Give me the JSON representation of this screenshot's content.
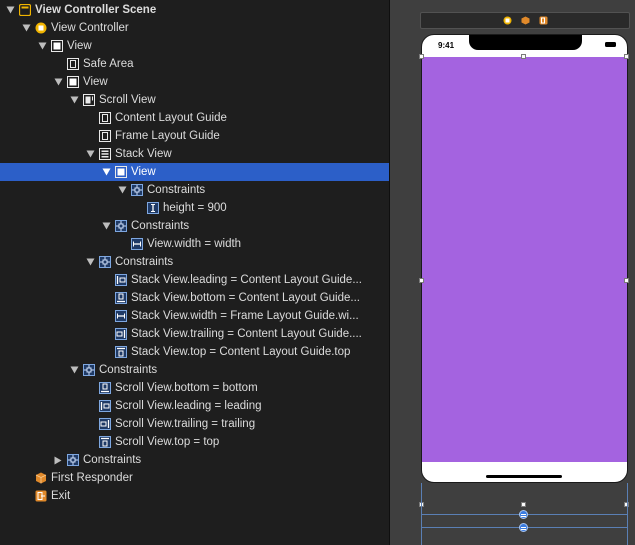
{
  "outline": {
    "items": [
      {
        "label": "View Controller Scene",
        "depth": 0,
        "expanded": true,
        "icon": "scene-icon",
        "bold": true
      },
      {
        "label": "View Controller",
        "depth": 1,
        "expanded": true,
        "icon": "view-controller-icon"
      },
      {
        "label": "View",
        "depth": 2,
        "expanded": true,
        "icon": "view-icon"
      },
      {
        "label": "Safe Area",
        "depth": 3,
        "expanded": null,
        "icon": "layout-guide-icon"
      },
      {
        "label": "View",
        "depth": 3,
        "expanded": true,
        "icon": "view-icon"
      },
      {
        "label": "Scroll View",
        "depth": 4,
        "expanded": true,
        "icon": "scroll-view-icon"
      },
      {
        "label": "Content Layout Guide",
        "depth": 5,
        "expanded": null,
        "icon": "layout-guide-icon"
      },
      {
        "label": "Frame Layout Guide",
        "depth": 5,
        "expanded": null,
        "icon": "layout-guide-icon"
      },
      {
        "label": "Stack View",
        "depth": 5,
        "expanded": true,
        "icon": "stack-view-icon"
      },
      {
        "label": "View",
        "depth": 6,
        "expanded": true,
        "icon": "view-icon",
        "selected": true
      },
      {
        "label": "Constraints",
        "depth": 7,
        "expanded": true,
        "icon": "constraints-icon"
      },
      {
        "label": "height = 900",
        "depth": 8,
        "expanded": null,
        "icon": "height-constraint-icon"
      },
      {
        "label": "Constraints",
        "depth": 6,
        "expanded": true,
        "icon": "constraints-icon"
      },
      {
        "label": "View.width = width",
        "depth": 7,
        "expanded": null,
        "icon": "width-constraint-icon"
      },
      {
        "label": "Constraints",
        "depth": 5,
        "expanded": true,
        "icon": "constraints-icon"
      },
      {
        "label": "Stack View.leading = Content Layout Guide...",
        "depth": 6,
        "expanded": null,
        "icon": "leading-constraint-icon"
      },
      {
        "label": "Stack View.bottom = Content Layout Guide...",
        "depth": 6,
        "expanded": null,
        "icon": "bottom-constraint-icon"
      },
      {
        "label": "Stack View.width = Frame Layout Guide.wi...",
        "depth": 6,
        "expanded": null,
        "icon": "width-constraint-icon"
      },
      {
        "label": "Stack View.trailing = Content Layout Guide....",
        "depth": 6,
        "expanded": null,
        "icon": "trailing-constraint-icon"
      },
      {
        "label": "Stack View.top = Content Layout Guide.top",
        "depth": 6,
        "expanded": null,
        "icon": "top-constraint-icon"
      },
      {
        "label": "Constraints",
        "depth": 4,
        "expanded": true,
        "icon": "constraints-icon"
      },
      {
        "label": "Scroll View.bottom = bottom",
        "depth": 5,
        "expanded": null,
        "icon": "bottom-constraint-icon"
      },
      {
        "label": "Scroll View.leading = leading",
        "depth": 5,
        "expanded": null,
        "icon": "leading-constraint-icon"
      },
      {
        "label": "Scroll View.trailing = trailing",
        "depth": 5,
        "expanded": null,
        "icon": "trailing-constraint-icon"
      },
      {
        "label": "Scroll View.top = top",
        "depth": 5,
        "expanded": null,
        "icon": "top-constraint-icon"
      },
      {
        "label": "Constraints",
        "depth": 3,
        "expanded": false,
        "icon": "constraints-icon"
      },
      {
        "label": "First Responder",
        "depth": 1,
        "expanded": null,
        "icon": "first-responder-icon"
      },
      {
        "label": "Exit",
        "depth": 1,
        "expanded": null,
        "icon": "exit-icon"
      }
    ]
  },
  "canvas": {
    "scene_bar_icons": [
      "view-controller-icon",
      "first-responder-icon",
      "exit-icon"
    ],
    "status_time": "9:41",
    "view_color": "#a463e0"
  },
  "colors": {
    "selection": "#2c5fc8",
    "panel_bg": "#1e1e1e",
    "canvas_bg": "#3f3f3f",
    "accent_yellow": "#f0b400",
    "accent_blue": "#3a7be0"
  }
}
